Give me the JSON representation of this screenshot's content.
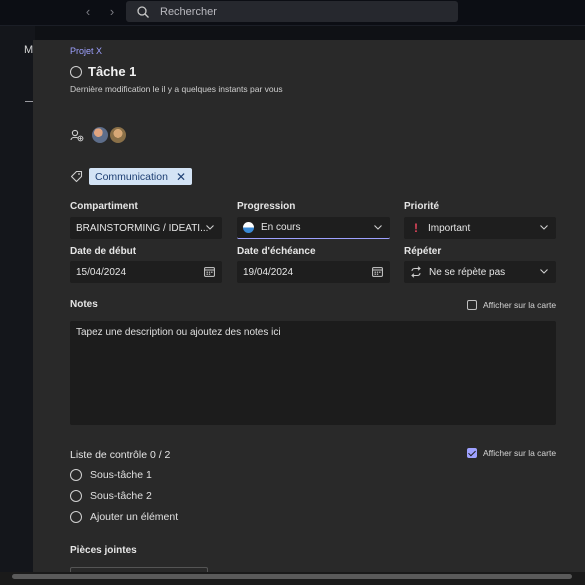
{
  "search": {
    "placeholder": "Rechercher"
  },
  "background": {
    "letter": "M"
  },
  "task": {
    "project": "Projet X",
    "title": "Tâche 1",
    "modified": "Dernière modification le il y a quelques instants par vous",
    "tag": "Communication"
  },
  "fields": {
    "bucket": {
      "label": "Compartiment",
      "value": "BRAINSTORMING / IDEATI..."
    },
    "progress": {
      "label": "Progression",
      "value": "En cours"
    },
    "priority": {
      "label": "Priorité",
      "value": "Important"
    },
    "start": {
      "label": "Date de début",
      "value": "15/04/2024"
    },
    "due": {
      "label": "Date d'échéance",
      "value": "19/04/2024"
    },
    "repeat": {
      "label": "Répéter",
      "value": "Ne se répète pas"
    }
  },
  "notes": {
    "label": "Notes",
    "show_on_card": "Afficher sur la carte",
    "placeholder": "Tapez une description ou ajoutez des notes ici"
  },
  "checklist": {
    "label": "Liste de contrôle 0 / 2",
    "show_on_card": "Afficher sur la carte",
    "items": [
      "Sous-tâche 1",
      "Sous-tâche 2"
    ],
    "add": "Ajouter un élément"
  },
  "attachments": {
    "label": "Pièces jointes"
  },
  "colors": {
    "accent": "#9ea1ff",
    "tag_bg": "#d3e3f5",
    "priority": "#e0455b",
    "panel": "#292929"
  }
}
